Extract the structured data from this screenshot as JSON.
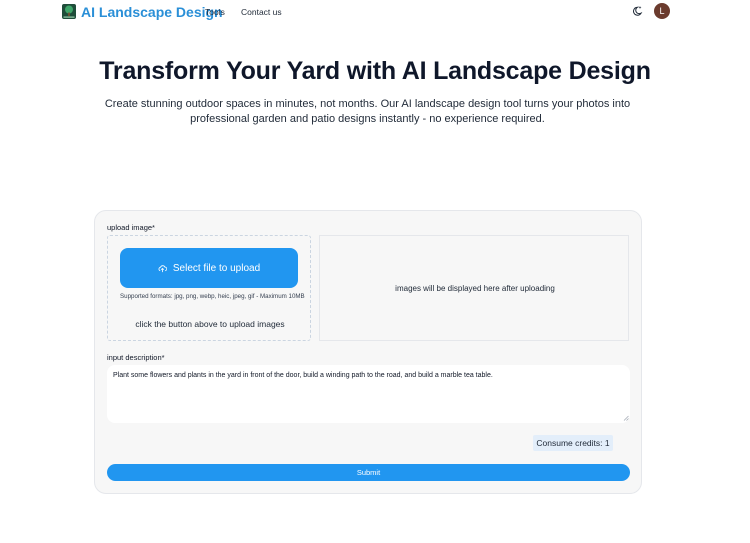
{
  "nav": {
    "brand": "AI Landscape Design",
    "links": [
      "Tools",
      "Contact us"
    ],
    "avatar_initial": "L",
    "theme_icon": "moon-sparkle-icon",
    "logo_icon": "tree-logo-icon"
  },
  "hero": {
    "title": "Transform Your Yard with AI Landscape Design",
    "subtitle": "Create stunning outdoor spaces in minutes, not months. Our AI landscape design tool turns your photos into professional garden and patio designs instantly - no experience required."
  },
  "form": {
    "upload_label": "upload image*",
    "upload_button": "Select file to upload",
    "upload_icon": "cloud-upload-icon",
    "formats": "Supported formats: jpg, png, webp, heic, jpeg, gif - Maximum 10MB",
    "upload_hint": "click the button above to upload images",
    "preview_text": "images will be displayed here after uploading",
    "description_label": "input description*",
    "description_value": "Plant some flowers and plants in the yard in front of the door, build a winding path to the road, and build a marble tea table.",
    "credits": "Consume credits: 1",
    "submit": "Submit"
  },
  "colors": {
    "brand": "#2a8fd7",
    "accent": "#2196f0",
    "credits_bg": "#e3eefa",
    "avatar_bg": "#6b3b2e"
  }
}
